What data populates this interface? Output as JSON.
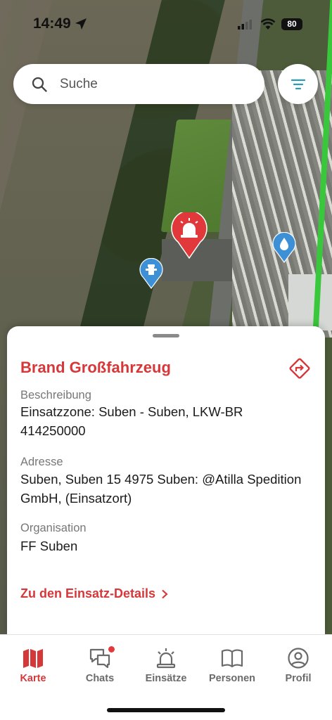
{
  "status_bar": {
    "time": "14:49",
    "battery": "80"
  },
  "search": {
    "placeholder": "Suche",
    "value": ""
  },
  "incident": {
    "title": "Brand Großfahrzeug",
    "fields": [
      {
        "label": "Beschreibung",
        "value": "Einsatzzone: Suben - Suben, LKW-BR 414250000"
      },
      {
        "label": "Adresse",
        "value": "Suben, Suben 15 4975 Suben: @Atilla Spedition GmbH, (Einsatzort)"
      },
      {
        "label": "Organisation",
        "value": "FF Suben"
      }
    ],
    "details_link": "Zu den Einsatz-Details"
  },
  "tabs": [
    {
      "label": "Karte",
      "icon": "map-icon",
      "active": true
    },
    {
      "label": "Chats",
      "icon": "chat-icon",
      "active": false,
      "badge": true
    },
    {
      "label": "Einsätze",
      "icon": "siren-icon",
      "active": false
    },
    {
      "label": "Personen",
      "icon": "book-icon",
      "active": false
    },
    {
      "label": "Profil",
      "icon": "profile-icon",
      "active": false
    }
  ],
  "colors": {
    "accent": "#d6383a",
    "marker_blue": "#3d8fd6"
  }
}
